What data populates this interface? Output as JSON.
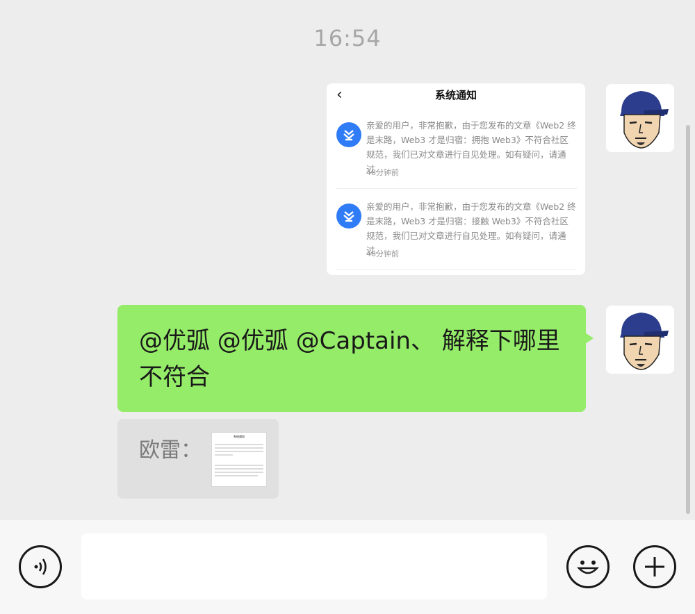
{
  "timestamp": "16:54",
  "messages": {
    "screenshot": {
      "title": "系统通知",
      "notices": [
        {
          "text": "亲爱的用户，非常抱歉，由于您发布的文章《Web2 终是末路，Web3 才是归宿：拥抱 Web3》不符合社区规范，我们已对文章进行自见处理。如有疑问，请通过…",
          "time": "48分钟前"
        },
        {
          "text": "亲爱的用户，非常抱歉，由于您发布的文章《Web2 终是末路，Web3 才是归宿：接触 Web3》不符合社区规范，我们已对文章进行自见处理。如有疑问，请通过…",
          "time": "48分钟前"
        }
      ]
    },
    "text_message": "@优弧 @优弧 @Captain、 解释下哪里不符合",
    "quote": {
      "name": "欧雷：",
      "thumb_title": "系统通知"
    }
  },
  "input": {
    "value": ""
  },
  "colors": {
    "background": "#ededed",
    "bubble_green": "#95ec69",
    "quote_bg": "#e0e0e0",
    "notice_icon": "#2f7cf6"
  },
  "icons": [
    "back-chevron-icon",
    "notice-app-icon",
    "voice-icon",
    "emoji-icon",
    "plus-icon",
    "avatar-cap-man"
  ]
}
